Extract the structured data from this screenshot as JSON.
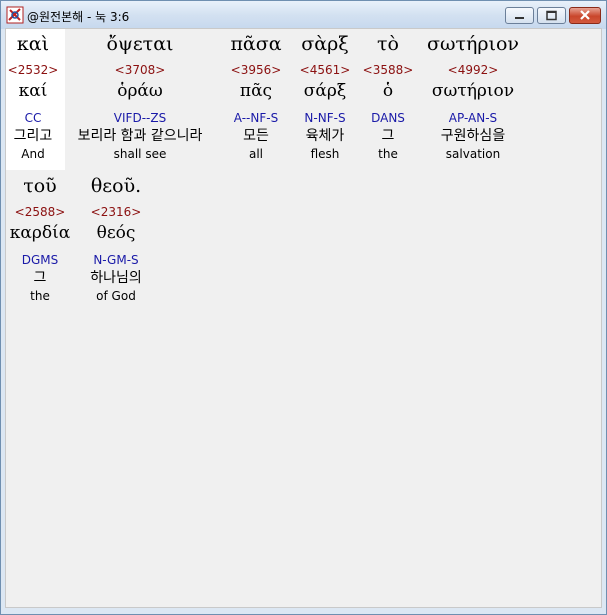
{
  "window": {
    "title": "@원전본해 - 눅 3:6",
    "icon": "app-icon",
    "controls": [
      "minimize-icon",
      "maximize-icon",
      "close-icon"
    ],
    "close_color": "#c9462c"
  },
  "colors": {
    "strongs": "#8b1010",
    "parsing": "#1a1aa8",
    "text": "#000000",
    "selected_bg": "#ffffff"
  },
  "words": [
    {
      "greek": "καὶ",
      "strongs": "<2532>",
      "lemma": "καί",
      "parsing": "CC",
      "korean": "그리고",
      "english": "And"
    },
    {
      "greek": "ὄψεται",
      "strongs": "<3708>",
      "lemma": "ὁράω",
      "parsing": "VIFD--ZS",
      "korean": "보리라 함과 같으니라",
      "english": "shall see"
    },
    {
      "greek": "πᾶσα",
      "strongs": "<3956>",
      "lemma": "πᾶς",
      "parsing": "A--NF-S",
      "korean": "모든",
      "english": "all"
    },
    {
      "greek": "σὰρξ",
      "strongs": "<4561>",
      "lemma": "σάρξ",
      "parsing": "N-NF-S",
      "korean": "육체가",
      "english": "flesh"
    },
    {
      "greek": "τὸ",
      "strongs": "<3588>",
      "lemma": "ὁ",
      "parsing": "DANS",
      "korean": "그",
      "english": "the"
    },
    {
      "greek": "σωτήριον",
      "strongs": "<4992>",
      "lemma": "σωτήριον",
      "parsing": "AP-AN-S",
      "korean": "구원하심을",
      "english": "salvation"
    },
    {
      "greek": "τοῦ",
      "strongs": "<2588>",
      "lemma": "καρδία",
      "parsing": "DGMS",
      "korean": "그",
      "english": "the"
    },
    {
      "greek": "θεοῦ.",
      "strongs": "<2316>",
      "lemma": "θεός",
      "parsing": "N-GM-S",
      "korean": "하나님의",
      "english": "of God"
    }
  ]
}
